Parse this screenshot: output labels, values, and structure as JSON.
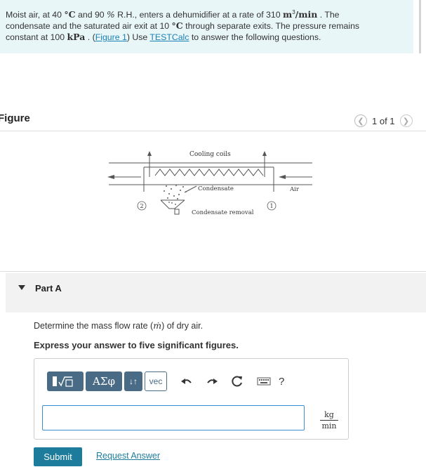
{
  "problem": {
    "seg1": "Moist air, at 40 ",
    "deg1": "°C",
    "seg2": " and 90 ",
    "percent": "%",
    "seg3": " R.H., enters a dehumidifier at a rate of 310 ",
    "rate_unit_m": "m",
    "rate_unit_exp": "3",
    "rate_unit_rest": "/min",
    "seg4": " . The",
    "line2_a": "condensate and the saturated air exit at 10 ",
    "deg2": "°C",
    "line2_b": " through separate exits. The pressure remains",
    "line3_a": "constant at 100 ",
    "kpa": "kPa",
    "line3_b": " . (",
    "figure_link": "Figure 1",
    "line3_c": ") Use ",
    "testcalc_link": "TESTCalc",
    "line3_d": " to answer the following questions."
  },
  "figure": {
    "label": "Figure",
    "pager_text": "1 of 1",
    "prev_icon": "chevron-left-icon",
    "next_icon": "chevron-right-icon",
    "diagram": {
      "cooling_coils": "Cooling coils",
      "condensate": "Condensate",
      "air": "Air",
      "condensate_removal": "Condensate removal",
      "state_exit": "2",
      "state_inlet": "1"
    }
  },
  "part_a": {
    "title": "Part A",
    "question_prefix": "Determine the mass flow rate (",
    "question_symbol": "ṁ",
    "question_suffix": ") of dry air.",
    "instruction": "Express your answer to five significant figures.",
    "toolbar": {
      "greek": "ΑΣφ",
      "arrows": "↓↑",
      "vec": "vec",
      "help": "?"
    },
    "input_value": "",
    "unit_num": "kg",
    "unit_den": "min",
    "submit": "Submit",
    "request_answer": "Request Answer"
  },
  "colors": {
    "problem_bg": "#e9f6f7",
    "toolbar_btn": "#4a6b86",
    "submit_bg": "#1d7c9c",
    "link": "#1a7fb5"
  }
}
